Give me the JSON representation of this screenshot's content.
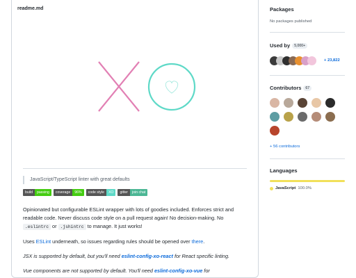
{
  "readme": {
    "filename": "readme.md",
    "logo_text": "XO",
    "tagline": "JavaScript/TypeScript linter with great defaults",
    "badges": [
      {
        "label": "build",
        "value": "passing",
        "color": "#4c1"
      },
      {
        "label": "coverage",
        "value": "96%",
        "color": "#4c1"
      },
      {
        "label": "code style",
        "value": "XO",
        "color": "#5ed9c7"
      },
      {
        "label": "gitter",
        "value": "join chat",
        "color": "#4bb694"
      }
    ],
    "p1_a": "Opinionated but configurable ESLint wrapper with lots of goodies included. Enforces strict and readable code. Never discuss code style on a pull request again! No decision-making. No ",
    "p1_code1": ".eslintrc",
    "p1_or": " or ",
    "p1_code2": ".jshintrc",
    "p1_b": " to manage. It just works!",
    "p2_a": "Uses ",
    "p2_link1": "ESLint",
    "p2_b": " underneath, so issues regarding rules should be opened over ",
    "p2_link2": "there",
    "p2_c": ".",
    "p3_a": "JSX is supported by default, but you'll need ",
    "p3_link": "eslint-config-xo-react",
    "p3_b": " for React specific linting.",
    "p4_a": "Vue components are not supported by default. You'll need ",
    "p4_link": "eslint-config-xo-vue",
    "p4_b": " for"
  },
  "sidebar": {
    "packages_title": "Packages",
    "packages_text": "No packages published",
    "used_by_title": "Used by",
    "used_by_count": "5,000+",
    "used_by_more": "+ 23,822",
    "contributors_title": "Contributors",
    "contributors_count": "67",
    "contributors_more": "+ 56 contributors",
    "languages_title": "Languages",
    "language_name": "JavaScript",
    "language_percent": "100.0%",
    "language_color": "#f1e05a"
  },
  "colors": {
    "x_pink": "#e280b4",
    "o_teal": "#5ed9c7",
    "link": "#0969da"
  }
}
